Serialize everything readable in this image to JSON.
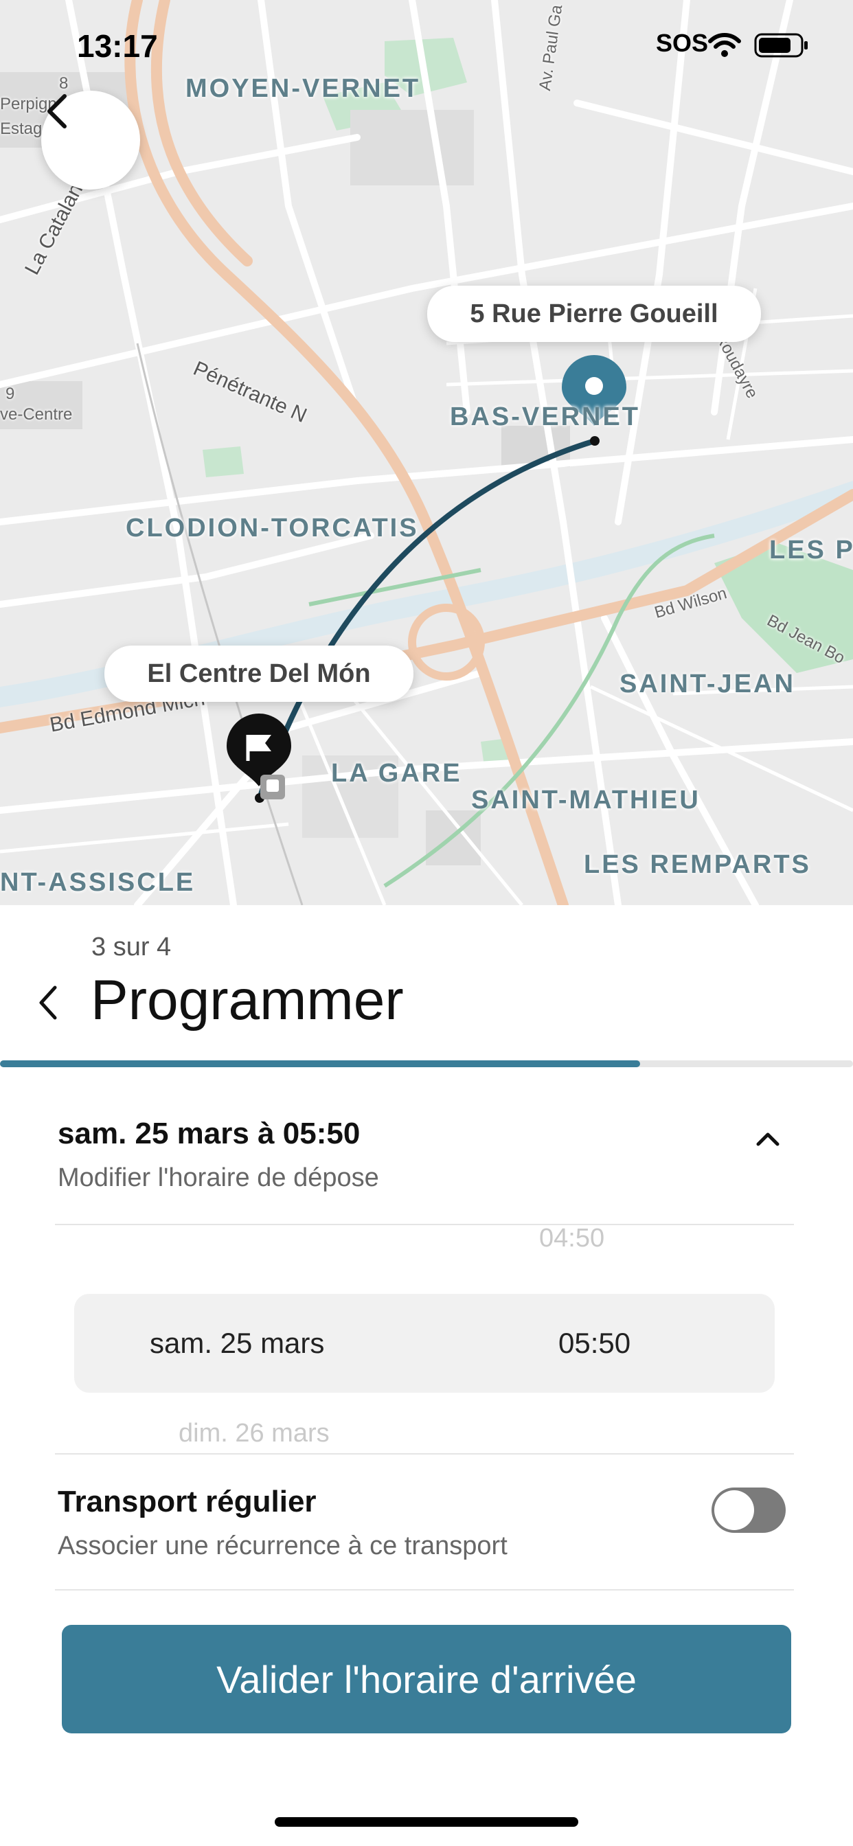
{
  "status_bar": {
    "time": "13:17",
    "sos": "SOS"
  },
  "map": {
    "districts": {
      "moyen_vernet": "MOYEN-VERNET",
      "bas_vernet": "BAS-VERNET",
      "clodion": "CLODION-TORCATIS",
      "les_p": "LES P",
      "saint_jean": "SAINT-JEAN",
      "la_gare": "LA GARE",
      "saint_mathieu": "SAINT-MATHIEU",
      "les_remparts": "LES REMPARTS",
      "assiscle": "NT-ASSISCLE"
    },
    "streets": {
      "la_catalane": "La Catalane",
      "penetrante": "Pénétrante N",
      "bd_edmond": "Bd Edmond Mich",
      "bd_wilson": "Bd Wilson",
      "bd_jean": "Bd Jean Bo",
      "roudayre": "Roudayre",
      "av_paul": "Av. Paul Ga",
      "perpign": "Perpign",
      "estag": "Estag",
      "ve_centre": "ve-Centre",
      "route_8": "8",
      "route_9": "9"
    },
    "destination_label": "5 Rue Pierre Goueill",
    "origin_label": "El Centre Del Món",
    "route_color": "#1e4a5e",
    "pin_color": "#3a7d98"
  },
  "sheet": {
    "step": "3 sur 4",
    "title": "Programmer",
    "progress": 0.75,
    "date_summary": "sam. 25 mars à 05:50",
    "date_hint": "Modifier l'horaire de dépose",
    "picker": {
      "above_time": "04:50",
      "selected_date": "sam. 25 mars",
      "selected_time": "05:50",
      "below_date": "dim. 26 mars"
    },
    "recurrence_title": "Transport régulier",
    "recurrence_sub": "Associer une récurrence à ce transport",
    "recurrence_enabled": false,
    "cta_label": "Valider l'horaire d'arrivée"
  }
}
